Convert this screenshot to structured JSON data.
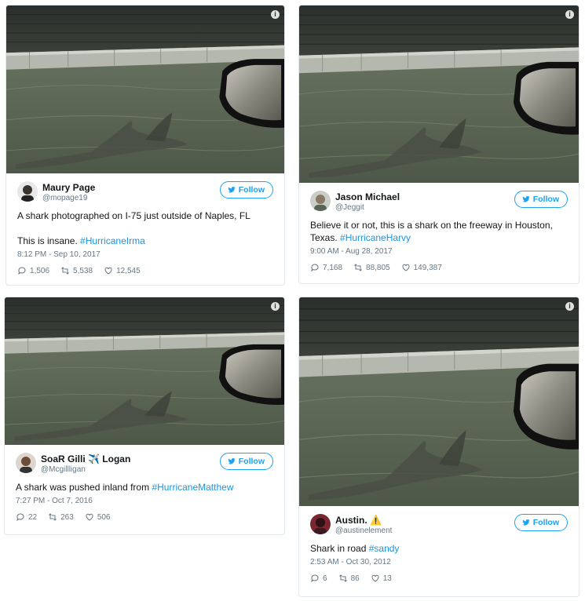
{
  "colors": {
    "accent": "#1da1f2",
    "link": "#1b95e0",
    "muted": "#657786",
    "border": "#e1e8ed"
  },
  "tweets": [
    {
      "name": "Maury Page",
      "handle": "@mopage19",
      "follow_label": "Follow",
      "text_line1": "A shark photographed on I-75 just outside of Naples, FL",
      "text_line2": "This is insane. ",
      "hashtag": "#HurricaneIrma",
      "time": "8:12 PM - Sep 10, 2017",
      "replies": "1,506",
      "retweets": "5,538",
      "likes": "12,545"
    },
    {
      "name": "Jason Michael",
      "handle": "@Jeggit",
      "follow_label": "Follow",
      "text_line1": "Believe it or not, this is a shark on the freeway in Houston,",
      "text_line2": "Texas. ",
      "hashtag": "#HurricaneHarvy",
      "time": "9:00 AM - Aug 28, 2017",
      "replies": "7,168",
      "retweets": "88,805",
      "likes": "149,387"
    },
    {
      "name": "SoaR Gilli ✈️ Logan",
      "handle": "@Mcgillligan",
      "follow_label": "Follow",
      "text_line1": "A shark was pushed inland from ",
      "hashtag": "#HurricaneMatthew",
      "time": "7:27 PM - Oct 7, 2016",
      "replies": "22",
      "retweets": "263",
      "likes": "506"
    },
    {
      "name": "Austin. ⚠️",
      "handle": "@austinelement",
      "follow_label": "Follow",
      "text_line1": "Shark in road ",
      "hashtag": "#sandy",
      "time": "2:53 AM - Oct 30, 2012",
      "replies": "6",
      "retweets": "86",
      "likes": "13"
    }
  ]
}
